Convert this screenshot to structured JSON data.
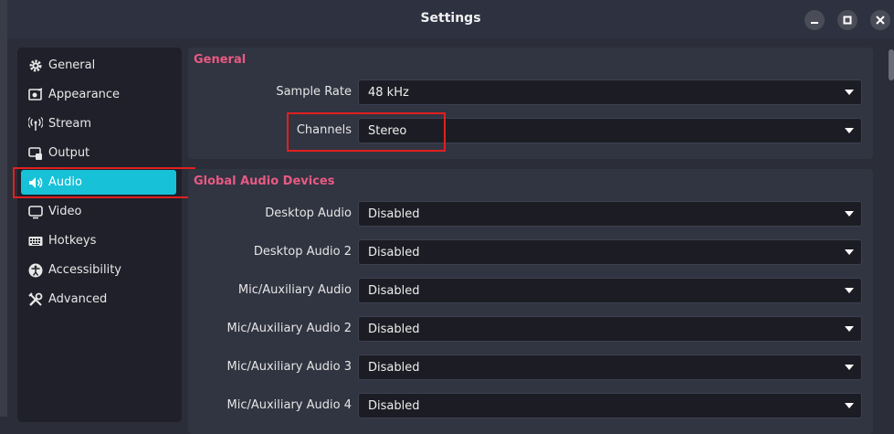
{
  "window": {
    "title": "Settings"
  },
  "sidebar": {
    "items": [
      {
        "label": "General",
        "icon": "gear-icon"
      },
      {
        "label": "Appearance",
        "icon": "appearance-icon"
      },
      {
        "label": "Stream",
        "icon": "broadcast-icon"
      },
      {
        "label": "Output",
        "icon": "output-icon"
      },
      {
        "label": "Audio",
        "icon": "speaker-icon",
        "active": true
      },
      {
        "label": "Video",
        "icon": "monitor-icon"
      },
      {
        "label": "Hotkeys",
        "icon": "keyboard-icon"
      },
      {
        "label": "Accessibility",
        "icon": "accessibility-icon"
      },
      {
        "label": "Advanced",
        "icon": "tools-icon"
      }
    ],
    "active_color": "#17c1d8"
  },
  "general": {
    "title": "General",
    "sample_rate": {
      "label": "Sample Rate",
      "value": "48 kHz"
    },
    "channels": {
      "label": "Channels",
      "value": "Stereo"
    }
  },
  "devices": {
    "title": "Global Audio Devices",
    "rows": [
      {
        "label": "Desktop Audio",
        "value": "Disabled"
      },
      {
        "label": "Desktop Audio 2",
        "value": "Disabled"
      },
      {
        "label": "Mic/Auxiliary Audio",
        "value": "Disabled"
      },
      {
        "label": "Mic/Auxiliary Audio 2",
        "value": "Disabled"
      },
      {
        "label": "Mic/Auxiliary Audio 3",
        "value": "Disabled"
      },
      {
        "label": "Mic/Auxiliary Audio 4",
        "value": "Disabled"
      }
    ]
  },
  "colors": {
    "section_title": "#e85a83",
    "highlight_box": "#e02020"
  }
}
